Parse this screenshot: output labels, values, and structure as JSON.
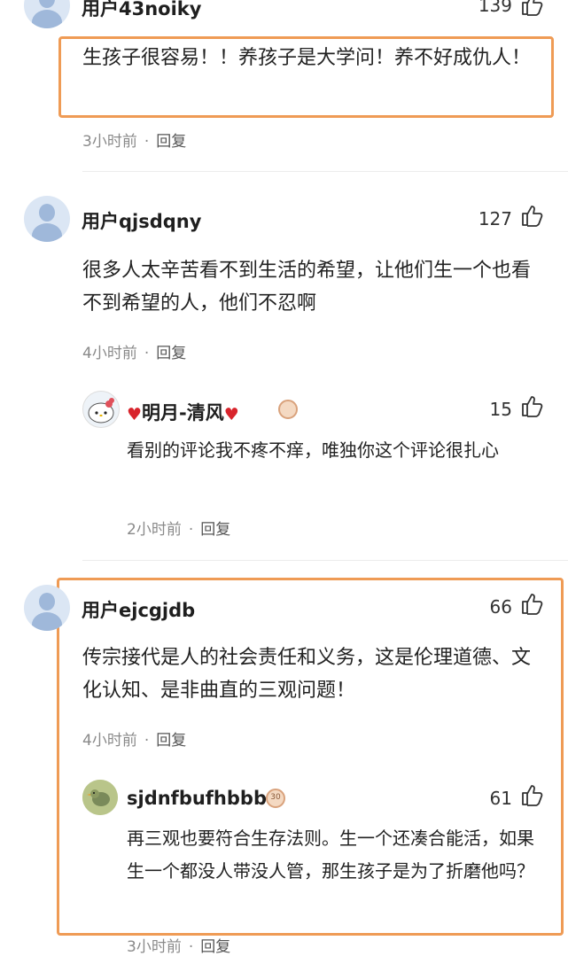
{
  "comments": [
    {
      "username": "用户43noiky",
      "likes": "139",
      "text": "生孩子很容易！！养孩子是大学问！养不好成仇人！",
      "time": "3小时前",
      "reply": "回复"
    },
    {
      "username": "用户qjsdqny",
      "likes": "127",
      "text": "很多人太辛苦看不到生活的希望，让他们生一个也看不到希望的人，他们不忍啊",
      "time": "4小时前",
      "reply": "回复",
      "subreply": {
        "username": "明月-清风",
        "likes": "15",
        "text": "看别的评论我不疼不痒，唯独你这个评论很扎心",
        "time": "2小时前",
        "reply": "回复"
      }
    },
    {
      "username": "用户ejcgjdb",
      "likes": "66",
      "text": "传宗接代是人的社会责任和义务，这是伦理道德、文化认知、是非曲直的三观问题！",
      "time": "4小时前",
      "reply": "回复",
      "subreply": {
        "username": "sjdnfbufhbbb",
        "badge": "30",
        "likes": "61",
        "text": "再三观也要符合生存法则。生一个还凑合能活，如果生一个都没人带没人管，那生孩子是为了折磨他吗？",
        "time": "3小时前",
        "reply": "回复"
      }
    }
  ],
  "separator": "·",
  "highlight_color": "#ef9b55",
  "heart_color": "#d8242c",
  "icons": [
    "default-avatar-icon",
    "thumbs-up-icon",
    "heart-icon",
    "level-badge-icon",
    "hello-kitty-avatar-icon",
    "bird-avatar-icon"
  ]
}
